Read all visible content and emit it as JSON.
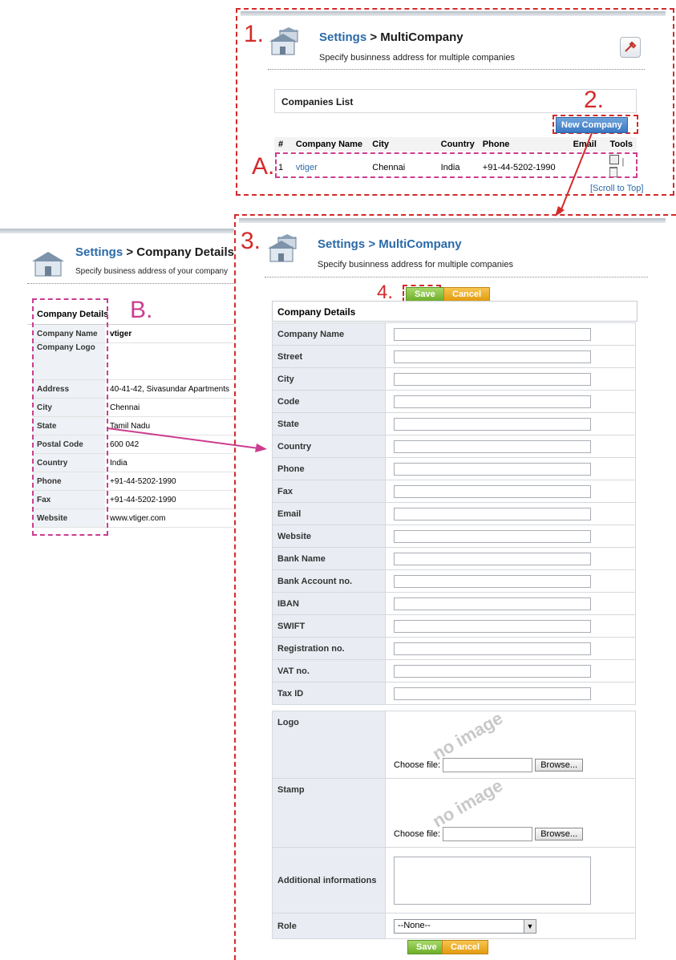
{
  "steps": {
    "s1": "1.",
    "s2": "2.",
    "s3": "3.",
    "s4": "4.",
    "sA": "A.",
    "sB": "B."
  },
  "multi": {
    "title_link": "Settings",
    "title_rest": " > MultiCompany",
    "subtitle": "Specify businness address for multiple companies",
    "list_title": "Companies List",
    "new_company": "New Company",
    "columns": [
      "#",
      "Company Name",
      "City",
      "Country",
      "Phone",
      "Email",
      "Tools"
    ],
    "row": {
      "num": "1",
      "name": "vtiger",
      "city": "Chennai",
      "country": "India",
      "phone": "+91-44-5202-1990",
      "email": ""
    },
    "scroll_top": "[Scroll to Top]"
  },
  "details": {
    "title_link": "Settings",
    "title_rest": " > Company Details",
    "subtitle": "Specify business address of your company",
    "header": "Company Details",
    "rows": [
      {
        "label": "Company Name",
        "value": "vtiger"
      },
      {
        "label": "Company Logo",
        "value": ""
      },
      {
        "label": "Address",
        "value": "40-41-42, Sivasundar Apartments"
      },
      {
        "label": "City",
        "value": "Chennai"
      },
      {
        "label": "State",
        "value": "Tamil Nadu"
      },
      {
        "label": "Postal Code",
        "value": "600 042"
      },
      {
        "label": "Country",
        "value": "India"
      },
      {
        "label": "Phone",
        "value": "+91-44-5202-1990"
      },
      {
        "label": "Fax",
        "value": "+91-44-5202-1990"
      },
      {
        "label": "Website",
        "value": "www.vtiger.com"
      }
    ]
  },
  "form": {
    "title_link": "Settings",
    "title_rest": " > MultiCompany",
    "subtitle": "Specify businness address for multiple companies",
    "save": "Save",
    "cancel": "Cancel",
    "header": "Company Details",
    "fields": [
      "Company Name",
      "Street",
      "City",
      "Code",
      "State",
      "Country",
      "Phone",
      "Fax",
      "Email",
      "Website",
      "Bank Name",
      "Bank Account no.",
      "IBAN",
      "SWIFT",
      "Registration no.",
      "VAT no.",
      "Tax ID"
    ],
    "logo_label": "Logo",
    "stamp_label": "Stamp",
    "no_image": "no image",
    "choose_file": "Choose file:",
    "browse": "Browse...",
    "additional_label": "Additional informations",
    "role_label": "Role",
    "role_value": "--None--"
  },
  "colors": {
    "annot_red": "#d42a2a",
    "annot_pink": "#cc3d8f",
    "link_blue": "#2a6aa8"
  }
}
